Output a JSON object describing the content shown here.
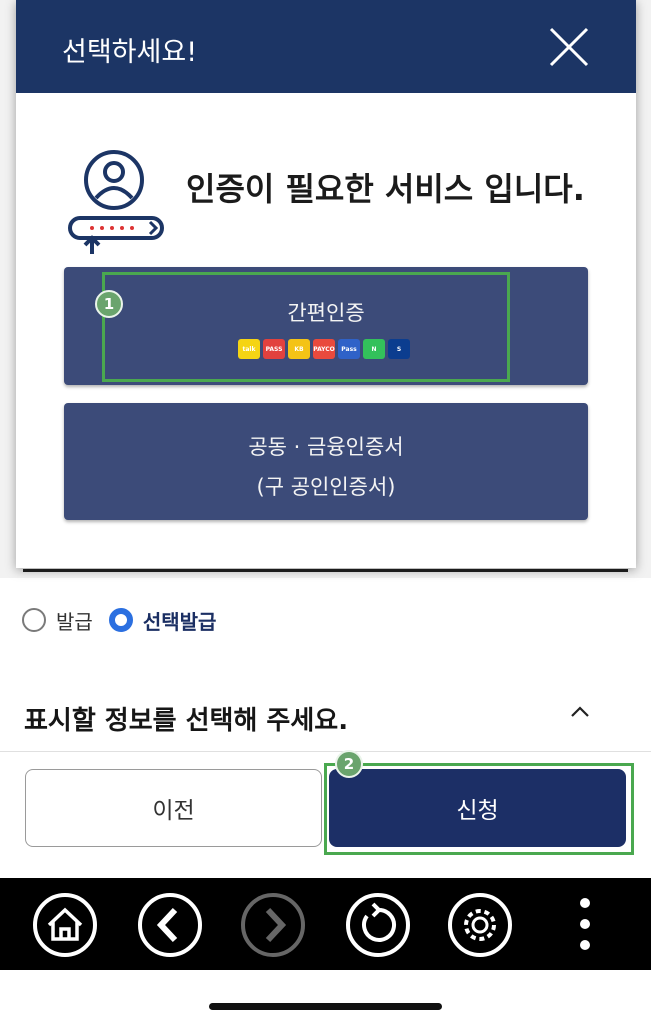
{
  "modal": {
    "title": "선택하세요!",
    "auth_message": "인증이 필요한 서비스 입니다.",
    "simple_auth_label": "간편인증",
    "cert_label_line1": "공동 · 금융인증서",
    "cert_label_line2": "(구 공인인증서)",
    "providers": [
      {
        "name": "kakao",
        "label": "talk",
        "color": "#f5d414"
      },
      {
        "name": "pass",
        "label": "PASS",
        "color": "#e2413e"
      },
      {
        "name": "kb",
        "label": "KB",
        "color": "#f4c316"
      },
      {
        "name": "payco",
        "label": "PAYCO",
        "color": "#e94a3d"
      },
      {
        "name": "samsung-pass",
        "label": "Pass",
        "color": "#2f62c8"
      },
      {
        "name": "naver",
        "label": "N",
        "color": "#33c15b"
      },
      {
        "name": "shinhan",
        "label": "S",
        "color": "#0b3d8f"
      }
    ]
  },
  "radio": {
    "option1": "발급",
    "option2": "선택발급",
    "selected": "선택발급"
  },
  "section": {
    "title": "표시할 정보를 선택해 주세요."
  },
  "buttons": {
    "prev": "이전",
    "apply": "신청"
  },
  "steps": {
    "step1": "1",
    "step2": "2"
  },
  "colors": {
    "header": "#1c3565",
    "option": "#3c4b79",
    "apply": "#1c2f66",
    "highlight": "#4aa84f"
  }
}
